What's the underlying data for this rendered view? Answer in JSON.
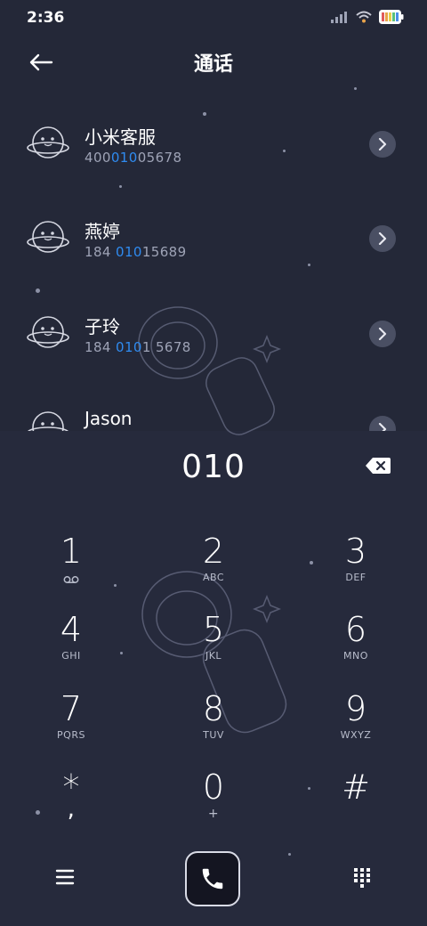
{
  "status_bar": {
    "time": "2:36",
    "icons": [
      "signal-icon",
      "wifi-icon",
      "battery-icon"
    ]
  },
  "header": {
    "title": "通话",
    "back_icon": "back-arrow-icon"
  },
  "contacts": [
    {
      "name": "小米客服",
      "number_parts": [
        {
          "t": "400",
          "hl": false
        },
        {
          "t": "010",
          "hl": true
        },
        {
          "t": "05678",
          "hl": false
        }
      ]
    },
    {
      "name": "燕婷",
      "number_parts": [
        {
          "t": "184 ",
          "hl": false
        },
        {
          "t": "010",
          "hl": true
        },
        {
          "t": "15689",
          "hl": false
        }
      ]
    },
    {
      "name": "子玲",
      "number_parts": [
        {
          "t": "184 ",
          "hl": false
        },
        {
          "t": "010",
          "hl": true
        },
        {
          "t": "1 5678",
          "hl": false
        }
      ]
    },
    {
      "name": "Jason",
      "number_parts": []
    }
  ],
  "dialer": {
    "input": "010",
    "backspace_icon": "backspace-icon",
    "keys": [
      {
        "digit": "1",
        "letters": "voicemail"
      },
      {
        "digit": "2",
        "letters": "ABC"
      },
      {
        "digit": "3",
        "letters": "DEF"
      },
      {
        "digit": "4",
        "letters": "GHI"
      },
      {
        "digit": "5",
        "letters": "JKL"
      },
      {
        "digit": "6",
        "letters": "MNO"
      },
      {
        "digit": "7",
        "letters": "PQRS"
      },
      {
        "digit": "8",
        "letters": "TUV"
      },
      {
        "digit": "9",
        "letters": "WXYZ"
      },
      {
        "digit": "*",
        "letters": ","
      },
      {
        "digit": "0",
        "letters": "+"
      },
      {
        "digit": "#",
        "letters": ""
      }
    ]
  },
  "bottom_bar": {
    "menu_icon": "menu-icon",
    "call_icon": "phone-icon",
    "keypad_icon": "keypad-icon"
  },
  "colors": {
    "background": "#262a3c",
    "highlight": "#2f8bf0"
  }
}
